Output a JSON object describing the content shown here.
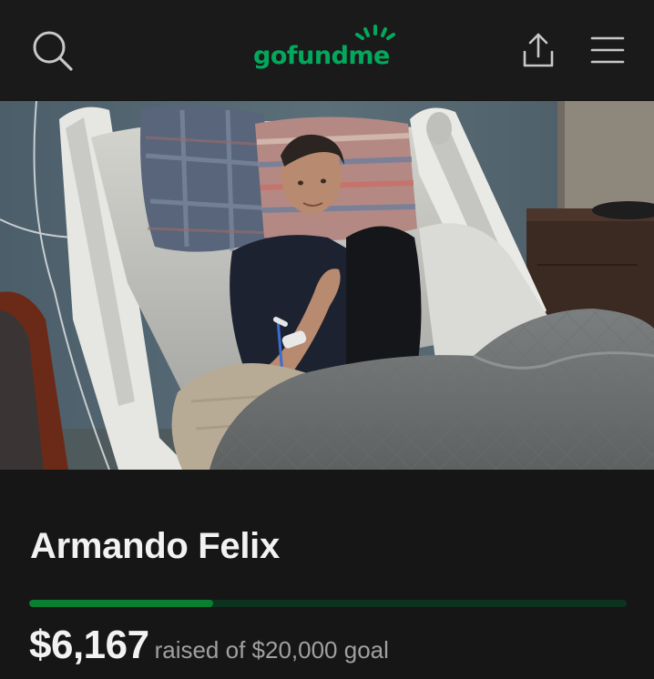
{
  "header": {
    "logo_text": "gofundme",
    "brand_color": "#02a95c",
    "icons": [
      "search-icon",
      "share-icon",
      "hamburger-menu-icon"
    ]
  },
  "campaign": {
    "title": "Armando Felix",
    "amount_raised": "$6,167",
    "raised_of_text": "raised of $20,000 goal",
    "progress_fraction": 0.308
  }
}
